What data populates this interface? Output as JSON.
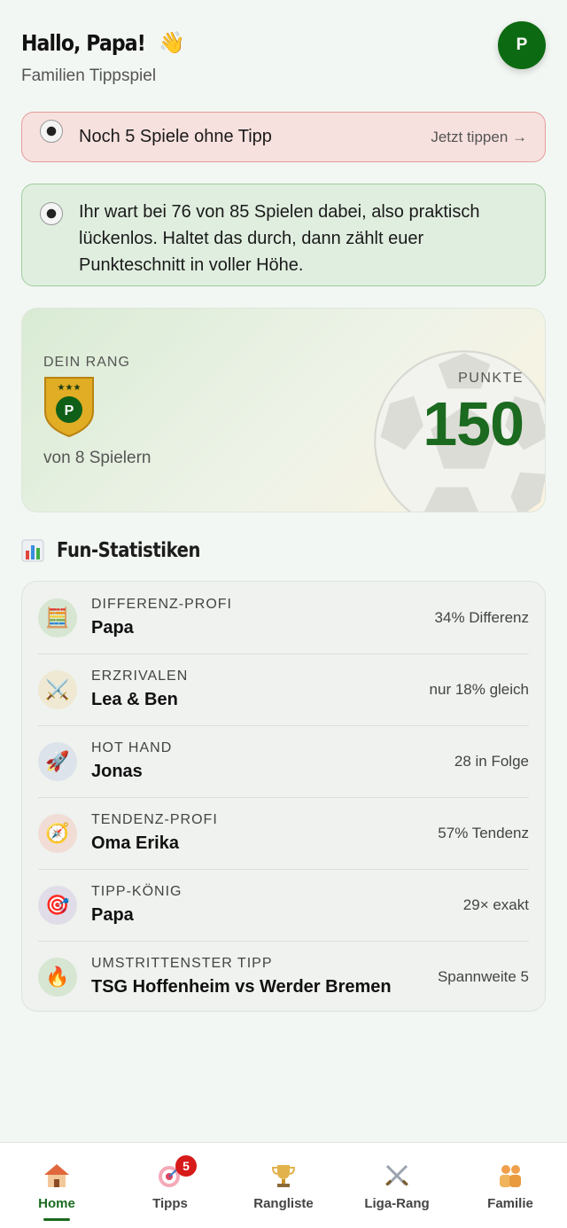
{
  "header": {
    "greeting": "Hallo, Papa!",
    "wave_emoji": "👋",
    "subtitle": "Familien Tippspiel",
    "avatar_initial": "P"
  },
  "alert": {
    "icon": "soccer-ball-icon",
    "text": "Noch 5 Spiele ohne Tipp",
    "link": "Jetzt tippen →"
  },
  "info": {
    "icon": "soccer-ball-icon",
    "text": "Ihr wart bei 76 von 85 Spielen dabei, also praktisch lückenlos. Haltet das durch, dann zählt euer Punkteschnitt in voller Höhe."
  },
  "rank": {
    "label": "DEIN RANG",
    "badge_letter": "P",
    "badge_stars": "★★★",
    "sub": "von 8 Spielern",
    "points_label": "PUNKTE",
    "points_value": "150"
  },
  "stats_section": {
    "title": "Fun-Statistiken",
    "icon": "bar-chart-icon",
    "rows": [
      {
        "label": "DIFFERENZ-PROFI",
        "name": "Papa",
        "value": "34% Differenz",
        "icon": "abacus-icon",
        "icon_bg": "#d6e6d2",
        "emoji": "🧮"
      },
      {
        "label": "ERZRIVALEN",
        "name": "Lea & Ben",
        "value": "nur 18% gleich",
        "icon": "crossed-swords-icon",
        "icon_bg": "#efe9d4",
        "emoji": "⚔️"
      },
      {
        "label": "HOT HAND",
        "name": "Jonas",
        "value": "28 in Folge",
        "icon": "rocket-icon",
        "icon_bg": "#dde3ea",
        "emoji": "🚀"
      },
      {
        "label": "TENDENZ-PROFI",
        "name": "Oma Erika",
        "value": "57% Tendenz",
        "icon": "compass-icon",
        "icon_bg": "#f1ddd6",
        "emoji": "🧭"
      },
      {
        "label": "TIPP-KÖNIG",
        "name": "Papa",
        "value": "29× exakt",
        "icon": "target-icon",
        "icon_bg": "#e1dde8",
        "emoji": "🎯"
      },
      {
        "label": "UMSTRITTENSTER TIPP",
        "name": "TSG Hoffenheim vs Werder Bremen",
        "value": "Spannweite 5",
        "icon": "fire-icon",
        "icon_bg": "#d6e6d2",
        "emoji": "🔥"
      }
    ]
  },
  "nav": {
    "items": [
      {
        "label": "Home",
        "icon": "house-icon",
        "active": true
      },
      {
        "label": "Tipps",
        "icon": "target-icon",
        "badge": "5"
      },
      {
        "label": "Rangliste",
        "icon": "trophy-icon"
      },
      {
        "label": "Liga-Rang",
        "icon": "crossed-swords-icon"
      },
      {
        "label": "Familie",
        "icon": "family-icon"
      }
    ]
  },
  "colors": {
    "accent": "#1b6a1f",
    "avatar": "#0c6b12",
    "alert_bg": "#f7e1de",
    "alert_border": "#e39b9b",
    "info_bg": "#e0eedf",
    "info_border": "#9fcc9f",
    "badge": "#d71a1a"
  }
}
